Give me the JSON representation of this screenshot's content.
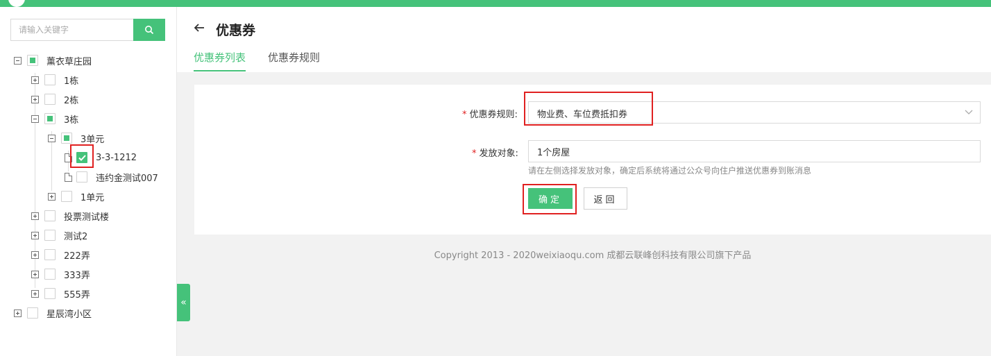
{
  "sidebar": {
    "search": {
      "placeholder": "请输入关键字"
    },
    "tree": [
      {
        "label": "薰衣草庄园",
        "toggle": "minus",
        "check": "partial"
      },
      {
        "label": "1栋",
        "toggle": "plus",
        "check": "none"
      },
      {
        "label": "2栋",
        "toggle": "plus",
        "check": "none"
      },
      {
        "label": "3栋",
        "toggle": "minus",
        "check": "partial"
      },
      {
        "label": "3单元",
        "toggle": "minus",
        "check": "partial"
      },
      {
        "label": "3-3-1212",
        "toggle": "leaf",
        "check": "checked"
      },
      {
        "label": "违约金测试007",
        "toggle": "leaf",
        "check": "none"
      },
      {
        "label": "1单元",
        "toggle": "plus",
        "check": "none"
      },
      {
        "label": "投票测试楼",
        "toggle": "plus",
        "check": "none"
      },
      {
        "label": "测试2",
        "toggle": "plus",
        "check": "none"
      },
      {
        "label": "222弄",
        "toggle": "plus",
        "check": "none"
      },
      {
        "label": "333弄",
        "toggle": "plus",
        "check": "none"
      },
      {
        "label": "555弄",
        "toggle": "plus",
        "check": "none"
      },
      {
        "label": "星辰湾小区",
        "toggle": "plus",
        "check": "none"
      }
    ],
    "collapse_glyph": "«"
  },
  "header": {
    "title": "优惠券",
    "tabs": [
      {
        "label": "优惠券列表",
        "active": true
      },
      {
        "label": "优惠券规则",
        "active": false
      }
    ]
  },
  "form": {
    "rule": {
      "label": "优惠券规则:",
      "value": "物业费、车位费抵扣券"
    },
    "target": {
      "label": "发放对象:",
      "value": "1个房屋",
      "hint": "请在左侧选择发放对象，确定后系统将通过公众号向住户推送优惠券到账消息"
    },
    "required_mark": "*",
    "confirm_label": "确定",
    "back_label": "返回"
  },
  "footer": {
    "text": "Copyright 2013 - 2020weixiaoqu.com 成都云联峰创科技有限公司旗下产品"
  },
  "colors": {
    "accent": "#45c27a",
    "highlight": "#e02020"
  }
}
